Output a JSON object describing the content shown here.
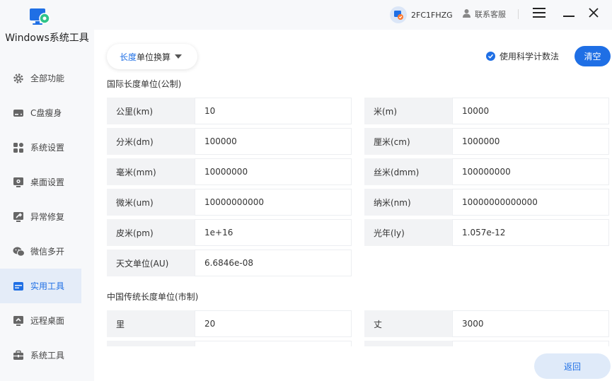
{
  "app": {
    "title": "Windows系统工具"
  },
  "header": {
    "user_id": "2FC1FHZG",
    "support_label": "联系客服"
  },
  "sidebar": {
    "items": [
      {
        "label": "全部功能",
        "icon": "gear-icon"
      },
      {
        "label": "C盘瘦身",
        "icon": "drive-icon"
      },
      {
        "label": "系统设置",
        "icon": "grid-icon"
      },
      {
        "label": "桌面设置",
        "icon": "desktop-gear-icon"
      },
      {
        "label": "异常修复",
        "icon": "monitor-wrench-icon"
      },
      {
        "label": "微信多开",
        "icon": "wechat-icon"
      },
      {
        "label": "实用工具",
        "icon": "window-icon",
        "active": true
      },
      {
        "label": "远程桌面",
        "icon": "remote-desktop-icon"
      },
      {
        "label": "系统工具",
        "icon": "toolbox-icon"
      }
    ]
  },
  "toolbar": {
    "selector_highlight": "长度",
    "selector_rest": "单位换算",
    "sci_notation_label": "使用科学计数法",
    "clear_label": "清空"
  },
  "metric": {
    "title": "国际长度单位(公制)",
    "rows": [
      [
        {
          "label": "公里(km)",
          "value": "10"
        },
        {
          "label": "米(m)",
          "value": "10000"
        }
      ],
      [
        {
          "label": "分米(dm)",
          "value": "100000"
        },
        {
          "label": "厘米(cm)",
          "value": "1000000"
        }
      ],
      [
        {
          "label": "毫米(mm)",
          "value": "10000000"
        },
        {
          "label": "丝米(dmm)",
          "value": "100000000"
        }
      ],
      [
        {
          "label": "微米(um)",
          "value": "10000000000"
        },
        {
          "label": "纳米(nm)",
          "value": "10000000000000"
        }
      ],
      [
        {
          "label": "皮米(pm)",
          "value": "1e+16"
        },
        {
          "label": "光年(ly)",
          "value": "1.057e-12"
        }
      ],
      [
        {
          "label": "天文单位(AU)",
          "value": "6.6846e-08"
        }
      ]
    ]
  },
  "chinese": {
    "title": "中国传统长度单位(市制)",
    "rows": [
      [
        {
          "label": "里",
          "value": "20"
        },
        {
          "label": "丈",
          "value": "3000"
        }
      ]
    ]
  },
  "footer": {
    "back_label": "返回"
  },
  "colors": {
    "accent": "#1f6fe5",
    "label_bg": "#f2f3f5",
    "sidebar_bg": "#f7f8fa"
  }
}
